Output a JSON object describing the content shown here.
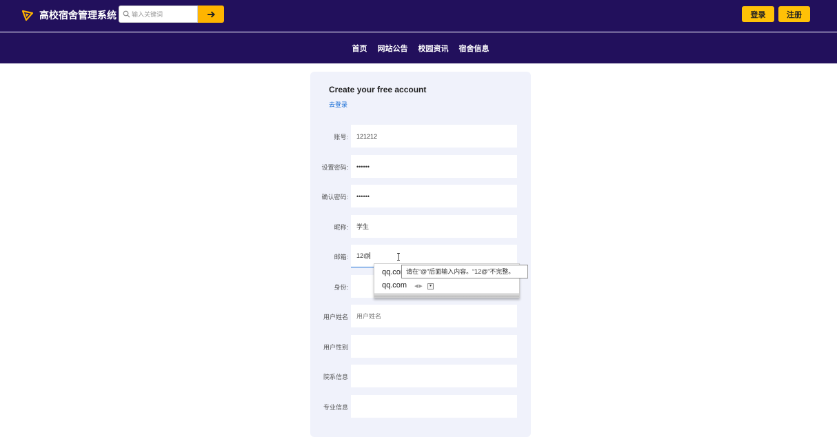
{
  "header": {
    "site_title": "高校宿舍管理系统",
    "logo_color": "#ffb400",
    "search": {
      "placeholder": "输入关键词",
      "value": ""
    },
    "search_button_icon": "arrow-right-icon",
    "login_label": "登录",
    "register_label": "注册"
  },
  "nav": {
    "items": [
      {
        "label": "首页"
      },
      {
        "label": "网站公告"
      },
      {
        "label": "校园资讯"
      },
      {
        "label": "宿舍信息"
      }
    ]
  },
  "form": {
    "title": "Create your free account",
    "login_link": "去登录",
    "fields": [
      {
        "label": "账号:",
        "value": "121212",
        "placeholder": ""
      },
      {
        "label": "设置密码:",
        "value": "••••••",
        "placeholder": ""
      },
      {
        "label": "确认密码:",
        "value": "••••••",
        "placeholder": ""
      },
      {
        "label": "昵称:",
        "value": "学生",
        "placeholder": ""
      },
      {
        "label": "邮箱:",
        "value": "12@",
        "placeholder": ""
      },
      {
        "label": "身份:",
        "value": "",
        "placeholder": ""
      },
      {
        "label": "用户姓名",
        "value": "",
        "placeholder": "用户姓名"
      },
      {
        "label": "用户性别",
        "value": "",
        "placeholder": ""
      },
      {
        "label": "院系信息",
        "value": "",
        "placeholder": ""
      },
      {
        "label": "专业信息",
        "value": "",
        "placeholder": ""
      }
    ]
  },
  "autocomplete": {
    "items": [
      {
        "label": "qq.com"
      },
      {
        "label": "qq.com"
      }
    ]
  },
  "tooltip": {
    "text": "请在“@”后面输入内容。“12@”不完整。"
  },
  "colors": {
    "header_bg": "#22105c",
    "accent": "#ffc107",
    "link": "#1a6fd6",
    "card_bg": "#f0f2fb"
  }
}
